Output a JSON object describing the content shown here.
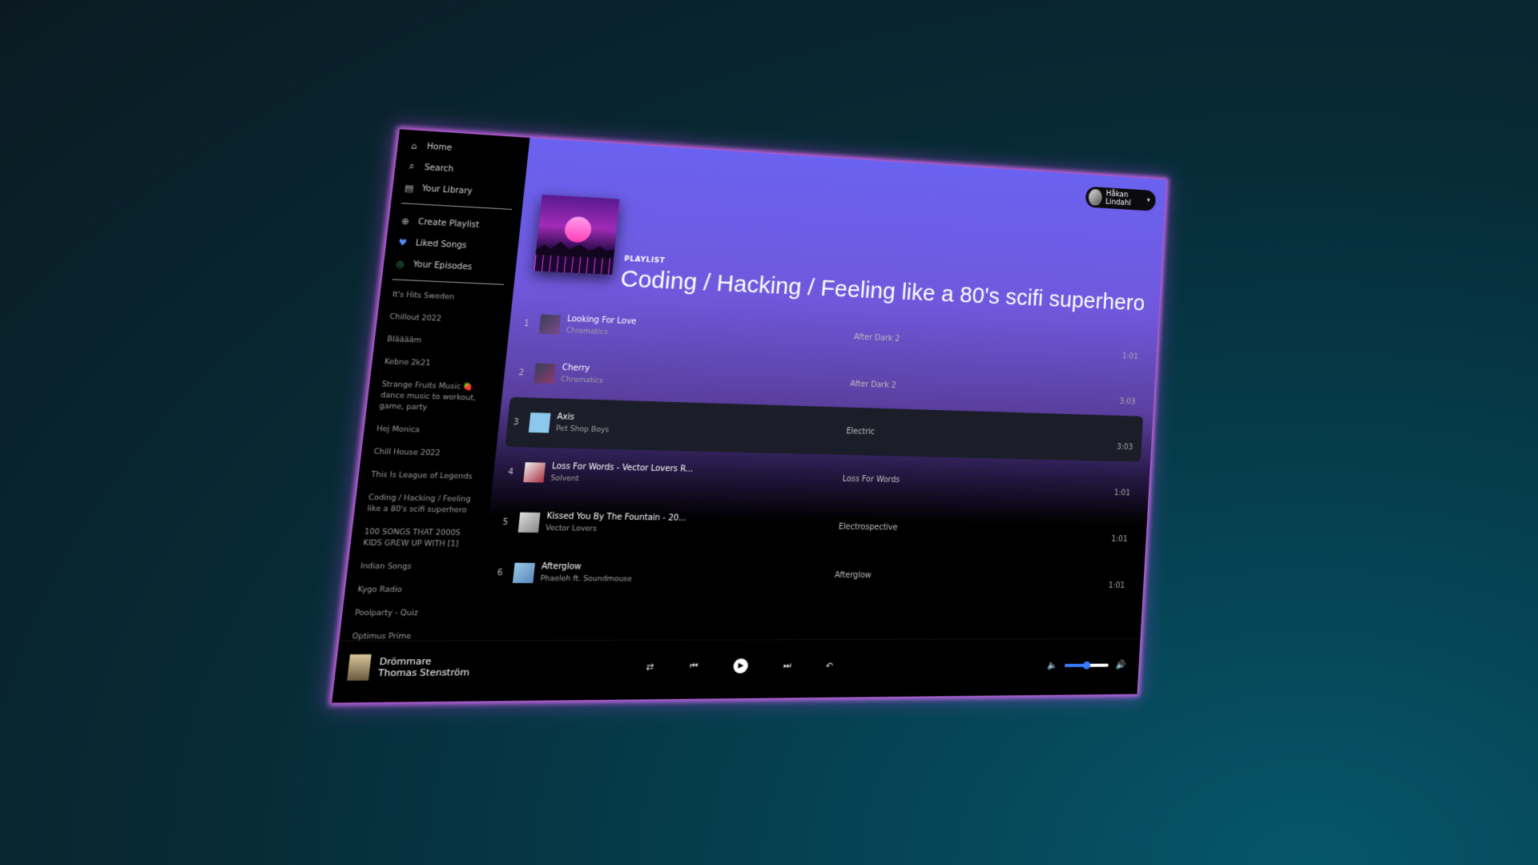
{
  "sidebar": {
    "nav": [
      {
        "icon": "home-icon",
        "label": "Home"
      },
      {
        "icon": "search-icon",
        "label": "Search"
      },
      {
        "icon": "library-icon",
        "label": "Your Library"
      }
    ],
    "actions": [
      {
        "icon": "plus-circle-icon",
        "label": "Create Playlist"
      },
      {
        "icon": "heart-icon",
        "label": "Liked Songs"
      },
      {
        "icon": "rss-icon",
        "label": "Your Episodes"
      }
    ],
    "playlists": [
      "It's Hits Sweden",
      "Chillout 2022",
      "Blääääm",
      "Kebne 2k21",
      "Strange Fruits Music 🍓 dance music to workout, game, party",
      "Hej Monica",
      "Chill House 2022",
      "This Is League of Legends",
      "Coding / Hacking / Feeling like a 80's scifi superhero",
      "100 SONGS THAT 2000S KIDS GREW UP WITH [1]",
      "Indian Songs",
      "Kygo Radio",
      "Poolparty - Quiz",
      "Optimus Prime"
    ]
  },
  "header": {
    "user_name": "Håkan Lindahl",
    "type_label": "PLAYLIST",
    "title": "Coding / Hacking / Feeling like a 80's scifi superhero"
  },
  "tracks": [
    {
      "num": "1",
      "name": "Looking For Love",
      "artist": "Chromatics",
      "album": "After Dark 2",
      "duration": "1:01"
    },
    {
      "num": "2",
      "name": "Cherry",
      "artist": "Chromatics",
      "album": "After Dark 2",
      "duration": "3:03"
    },
    {
      "num": "3",
      "name": "Axis",
      "artist": "Pet Shop Boys",
      "album": "Electric",
      "duration": "3:03"
    },
    {
      "num": "4",
      "name": "Loss For Words - Vector Lovers R...",
      "artist": "Solvent",
      "album": "Loss For Words",
      "duration": "1:01"
    },
    {
      "num": "5",
      "name": "Kissed You By The Fountain - 20...",
      "artist": "Vector Lovers",
      "album": "Electrospective",
      "duration": "1:01"
    },
    {
      "num": "6",
      "name": "Afterglow",
      "artist": "Phaeleh ft. Soundmouse",
      "album": "Afterglow",
      "duration": "1:01"
    }
  ],
  "player": {
    "title": "Drömmare",
    "artist": "Thomas Stenström",
    "volume": 0.5
  },
  "colors": {
    "accent": "#3b7cff",
    "glow": "#e66eff"
  }
}
